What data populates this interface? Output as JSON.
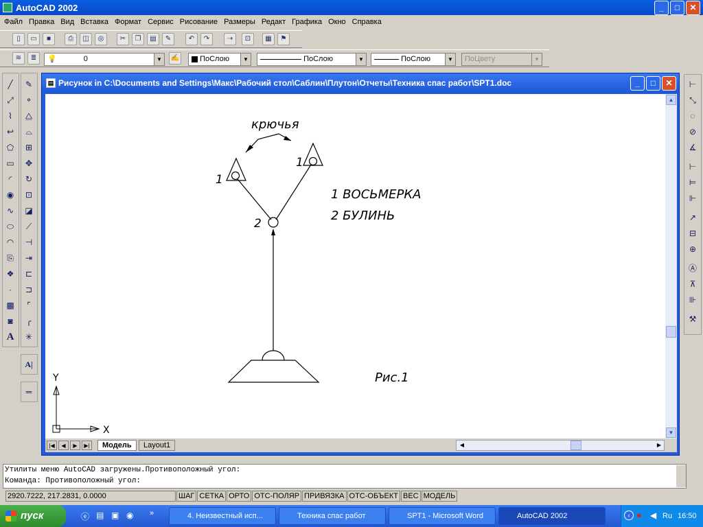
{
  "app": {
    "title": "AutoCAD 2002"
  },
  "menu": [
    "Файл",
    "Правка",
    "Вид",
    "Вставка",
    "Формат",
    "Сервис",
    "Рисование",
    "Размеры",
    "Редакт",
    "Графика",
    "Окно",
    "Справка"
  ],
  "layer_toolbar": {
    "layer": "0",
    "color": "ПоСлою",
    "linetype": "ПоСлою",
    "lineweight": "ПоСлою",
    "plotstyle": "ПоЦвету"
  },
  "drawing_window": {
    "title": "Рисунок in C:\\Documents and Settings\\Макс\\Рабочий стол\\Саблин\\Плутон\\Отчеты\\Техника спас работ\\SPT1.doc"
  },
  "drawing": {
    "hooks_label": "крючья",
    "label_1a": "1",
    "label_1b": "1",
    "label_2": "2",
    "legend_1": "1  ВОСЬМЕРКА",
    "legend_2": "2  БУЛИНЬ",
    "caption": "Рис.1",
    "axis_x": "X",
    "axis_y": "Y"
  },
  "tabs": {
    "model": "Модель",
    "layout1": "Layout1"
  },
  "command": {
    "line1": "Утилиты меню AutoCAD загружены.Противоположный угол:",
    "line2": "Команда: Противоположный угол:"
  },
  "status": {
    "coords": "2920.7222, 217.2831, 0.0000",
    "buttons": [
      "ШАГ",
      "СЕТКА",
      "ОРТО",
      "ОТС-ПОЛЯР",
      "ПРИВЯЗКА",
      "ОТС-ОБЪЕКТ",
      "ВЕС",
      "МОДЕЛЬ"
    ]
  },
  "taskbar": {
    "start": "пуск",
    "tasks": [
      "4. Неизвестный исп...",
      "Техника спас работ",
      "SPT1 - Microsoft Word",
      "AutoCAD 2002"
    ],
    "lang": "Ru",
    "clock": "16:50"
  }
}
